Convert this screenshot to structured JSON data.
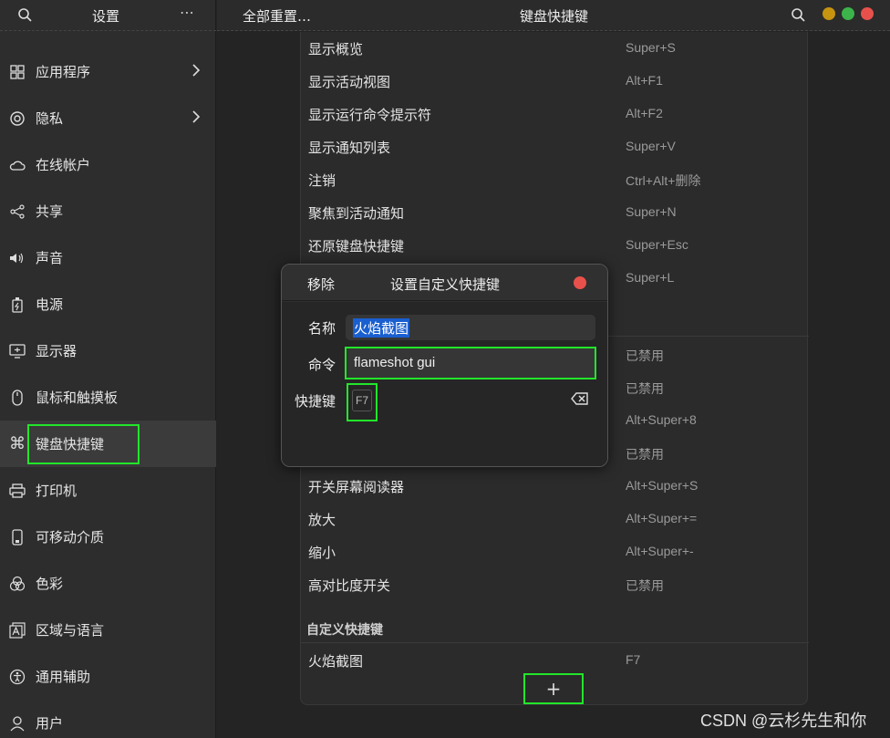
{
  "sidebar": {
    "title": "设置",
    "menu_icon": "⋯",
    "items": [
      {
        "label": "应用程序",
        "icon": "apps-icon",
        "chevron": true
      },
      {
        "label": "隐私",
        "icon": "privacy-icon",
        "chevron": true
      },
      {
        "label": "在线帐户",
        "icon": "cloud-icon",
        "chevron": false
      },
      {
        "label": "共享",
        "icon": "share-icon",
        "chevron": false
      },
      {
        "label": "声音",
        "icon": "speaker-icon",
        "chevron": false
      },
      {
        "label": "电源",
        "icon": "power-icon",
        "chevron": false
      },
      {
        "label": "显示器",
        "icon": "display-icon",
        "chevron": false
      },
      {
        "label": "鼠标和触摸板",
        "icon": "mouse-icon",
        "chevron": false
      },
      {
        "label": "键盘快捷键",
        "icon": "command-key-icon",
        "chevron": false,
        "active": true
      },
      {
        "label": "打印机",
        "icon": "printer-icon",
        "chevron": false
      },
      {
        "label": "可移动介质",
        "icon": "removable-media-icon",
        "chevron": false
      },
      {
        "label": "色彩",
        "icon": "color-icon",
        "chevron": false
      },
      {
        "label": "区域与语言",
        "icon": "language-icon",
        "chevron": false
      },
      {
        "label": "通用辅助",
        "icon": "accessibility-icon",
        "chevron": false
      },
      {
        "label": "用户",
        "icon": "user-icon",
        "chevron": false
      }
    ]
  },
  "header": {
    "reset_all": "全部重置…",
    "title": "键盘快捷键"
  },
  "window_controls": {
    "colors": [
      "#c7940f",
      "#3cb44a",
      "#e8514b"
    ]
  },
  "shortcuts": [
    {
      "name": "显示概览",
      "keys": "Super+S"
    },
    {
      "name": "显示活动视图",
      "keys": "Alt+F1"
    },
    {
      "name": "显示运行命令提示符",
      "keys": "Alt+F2"
    },
    {
      "name": "显示通知列表",
      "keys": "Super+V"
    },
    {
      "name": "注销",
      "keys": "Ctrl+Alt+删除"
    },
    {
      "name": "聚焦到活动通知",
      "keys": "Super+N"
    },
    {
      "name": "还原键盘快捷键",
      "keys": "Super+Esc"
    },
    {
      "name": "",
      "keys": "Super+L"
    },
    {
      "name": "",
      "keys": "已禁用"
    },
    {
      "name": "",
      "keys": "已禁用"
    },
    {
      "name": "",
      "keys": "Alt+Super+8"
    },
    {
      "name": "",
      "keys": "已禁用"
    },
    {
      "name": "开关屏幕阅读器",
      "keys": "Alt+Super+S"
    },
    {
      "name": "放大",
      "keys": "Alt+Super+="
    },
    {
      "name": "缩小",
      "keys": "Alt+Super+-"
    },
    {
      "name": "高对比度开关",
      "keys": "已禁用"
    }
  ],
  "custom_section": {
    "heading": "自定义快捷键",
    "items": [
      {
        "name": "火焰截图",
        "keys": "F7"
      }
    ],
    "add_label": "+"
  },
  "dialog": {
    "remove_label": "移除",
    "title": "设置自定义快捷键",
    "name_label": "名称",
    "name_value": "火焰截图",
    "command_label": "命令",
    "command_value": "flameshot gui",
    "shortcut_label": "快捷键",
    "shortcut_value": "F7"
  },
  "watermark": "CSDN @云杉先生和你"
}
